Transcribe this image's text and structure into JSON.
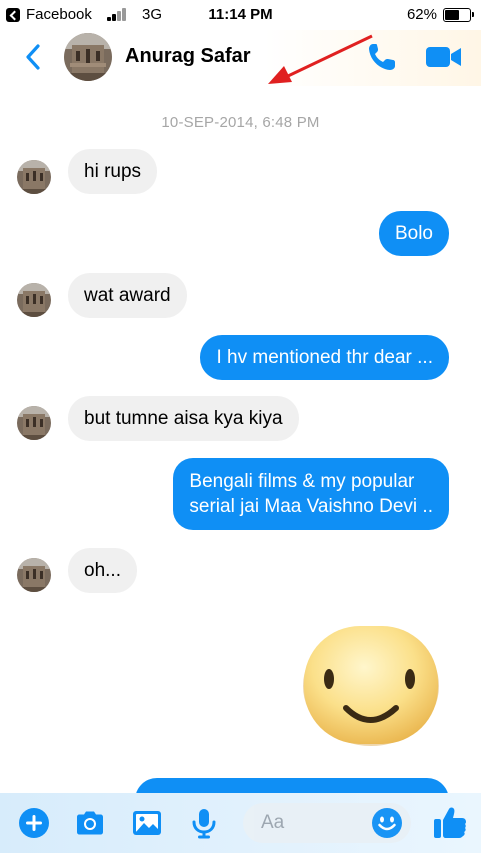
{
  "status_bar": {
    "back_app": "Facebook",
    "network": "3G",
    "time": "11:14 PM",
    "battery": "62%",
    "battery_level": 0.62
  },
  "header": {
    "contact_name": "Anurag Safar"
  },
  "conversation": {
    "timestamp": "10-SEP-2014, 6:48 PM",
    "messages": [
      {
        "from": "them",
        "text": "hi rups"
      },
      {
        "from": "me",
        "text": "Bolo"
      },
      {
        "from": "them",
        "text": "wat award"
      },
      {
        "from": "me",
        "text": "I hv mentioned thr dear ..."
      },
      {
        "from": "them",
        "text": "but tumne aisa kya kiya"
      },
      {
        "from": "me",
        "text_line1": "Bengali films & my popular",
        "text_line2": "serial jai Maa Vaishno Devi .."
      },
      {
        "from": "them",
        "text": "oh..."
      }
    ]
  },
  "composer": {
    "placeholder": "Aa"
  },
  "colors": {
    "accent": "#0f8ff5",
    "incoming_bubble": "#f0f0f0",
    "annotation_arrow": "#e02020"
  },
  "icons": [
    "back-chevron-icon",
    "phone-icon",
    "video-camera-icon",
    "plus-icon",
    "camera-icon",
    "gallery-icon",
    "microphone-icon",
    "emoji-icon",
    "thumbs-up-icon"
  ]
}
